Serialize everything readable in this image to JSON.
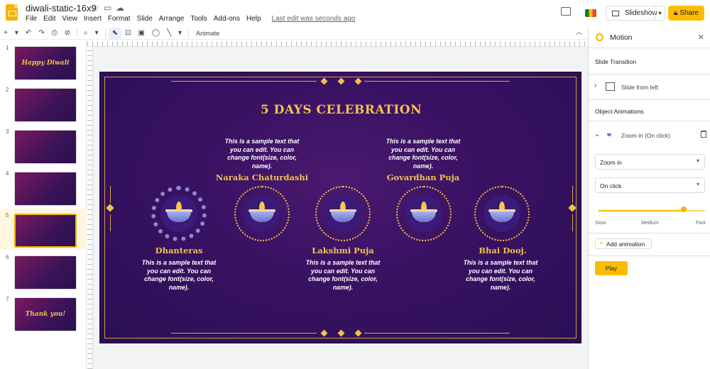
{
  "title": {
    "doc_name": "diwali-static-16x9",
    "star_icon": "star-icon",
    "folder_icon": "folder-icon",
    "cloud_icon": "cloud-icon",
    "menus": [
      "File",
      "Edit",
      "View",
      "Insert",
      "Format",
      "Slide",
      "Arrange",
      "Tools",
      "Add-ons",
      "Help"
    ],
    "last_edit": "Last edit was seconds ago",
    "slideshow_label": "Slideshow",
    "share_label": "Share"
  },
  "toolbar": {
    "buttons": [
      "+",
      "▾",
      "↶",
      "↷",
      "⎙",
      "⊘",
      "⌕",
      "▾",
      "⬉",
      "⊡",
      "▣",
      "◯",
      "╲",
      "▾"
    ],
    "animate_label": "Animate"
  },
  "filmstrip": {
    "slides": [
      {
        "num": "1",
        "label": "Happy Diwali"
      },
      {
        "num": "2",
        "label": ""
      },
      {
        "num": "3",
        "label": ""
      },
      {
        "num": "4",
        "label": ""
      },
      {
        "num": "5",
        "label": ""
      },
      {
        "num": "6",
        "label": ""
      },
      {
        "num": "7",
        "label": "Thank you!"
      }
    ],
    "selected_index": 4
  },
  "slide": {
    "title": "5 DAYS CELEBRATION",
    "days": [
      {
        "name": "Dhanteras",
        "desc": "This is a sample text that you can edit. You can change font(size, color, name)."
      },
      {
        "name": "Naraka Chaturdashi",
        "desc": "This is a sample text that you can edit. You can change font(size, color, name)."
      },
      {
        "name": "Lakshmi Puja",
        "desc": "This is a sample text that you can edit. You can change font(size, color, name)."
      },
      {
        "name": "Govardhan Puja",
        "desc": "This is a sample text that you can edit. You can change font(size, color, name)."
      },
      {
        "name": "Bhai Dooj.",
        "desc": "This is a sample text that you can edit. You can change font(size, color, name)."
      }
    ]
  },
  "panel": {
    "title": "Motion",
    "slide_transition_label": "Slide Transition",
    "transition_name": "Slide from left",
    "object_animations_label": "Object Animations",
    "animation_item": "Zoom in  (On click)",
    "effect_select": "Zoom in",
    "trigger_select": "On click",
    "speed_labels": {
      "slow": "Slow",
      "medium": "Medium",
      "fast": "Fast"
    },
    "speed_value": 0.8,
    "add_animation_label": "Add animation",
    "play_label": "Play"
  },
  "colors": {
    "accent": "#fbbc04",
    "slide_gold": "#f2c14e",
    "slide_bg": "#3a1263"
  }
}
